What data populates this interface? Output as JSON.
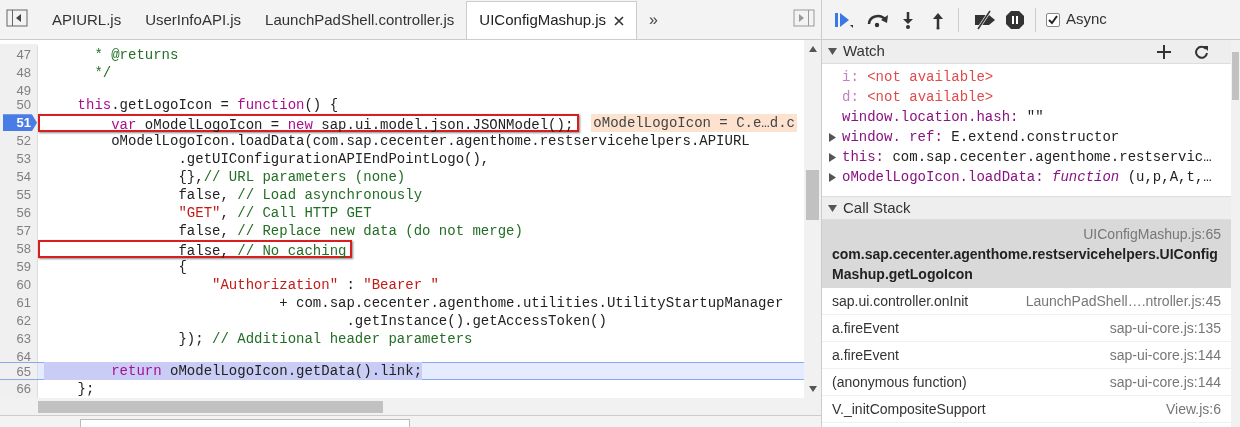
{
  "editor": {
    "tabs": [
      {
        "label": "APIURL.js",
        "selected": false,
        "closable": false
      },
      {
        "label": "UserInfoAPI.js",
        "selected": false,
        "closable": false
      },
      {
        "label": "LaunchPadShell.controller.js",
        "selected": false,
        "closable": false
      },
      {
        "label": "UIConfigMashup.js",
        "selected": true,
        "closable": true
      }
    ],
    "overflow": "»",
    "lines": [
      {
        "number": "47",
        "current": false,
        "selected": false,
        "boxed": false,
        "tokens": [
          {
            "t": "      * @returns",
            "kind": "comment"
          }
        ]
      },
      {
        "number": "48",
        "current": false,
        "selected": false,
        "boxed": false,
        "tokens": [
          {
            "t": "      */",
            "kind": "comment"
          }
        ]
      },
      {
        "number": "49",
        "current": false,
        "selected": false
      },
      {
        "number": "50",
        "current": false,
        "selected": false,
        "boxed": false,
        "tokens": [
          {
            "t": "    this",
            "kind": "keyword"
          },
          {
            "t": ".getLogoIcon = ",
            "kind": "plain"
          },
          {
            "t": "function",
            "kind": "keyword"
          },
          {
            "t": "() {",
            "kind": "plain"
          }
        ]
      },
      {
        "number": "51",
        "current": true,
        "selected": false,
        "boxed": true,
        "inline_value": "oModelLogoIcon = C.e…d.c",
        "tokens": [
          {
            "t": "        var",
            "kind": "keyword"
          },
          {
            "t": " oModelLogoIcon = ",
            "kind": "plain"
          },
          {
            "t": "new",
            "kind": "keyword"
          },
          {
            "t": " sap.ui.model.json.JSONModel();",
            "kind": "plain"
          }
        ]
      },
      {
        "number": "52",
        "current": false,
        "selected": false,
        "boxed": false,
        "tokens": [
          {
            "t": "        oModelLogoIcon.loadData(com.sap.cecenter.agenthome.restservicehelpers.APIURL",
            "kind": "plain"
          }
        ]
      },
      {
        "number": "53",
        "current": false,
        "selected": false,
        "boxed": false,
        "tokens": [
          {
            "t": "                .getUIConfigurationAPIEndPointLogo(),",
            "kind": "plain"
          }
        ]
      },
      {
        "number": "54",
        "current": false,
        "selected": false,
        "boxed": false,
        "tokens": [
          {
            "t": "                {},",
            "kind": "plain"
          },
          {
            "t": "// URL parameters (none)",
            "kind": "comment"
          }
        ]
      },
      {
        "number": "55",
        "current": false,
        "selected": false,
        "boxed": false,
        "tokens": [
          {
            "t": "                false, ",
            "kind": "plain"
          },
          {
            "t": "// Load asynchronously",
            "kind": "comment"
          }
        ]
      },
      {
        "number": "56",
        "current": false,
        "selected": false,
        "boxed": false,
        "tokens": [
          {
            "t": "                \"GET\"",
            "kind": "string"
          },
          {
            "t": ", ",
            "kind": "plain"
          },
          {
            "t": "// Call HTTP GET",
            "kind": "comment"
          }
        ]
      },
      {
        "number": "57",
        "current": false,
        "selected": false,
        "boxed": false,
        "tokens": [
          {
            "t": "                false, ",
            "kind": "plain"
          },
          {
            "t": "// Replace new data (do not merge)",
            "kind": "comment"
          }
        ]
      },
      {
        "number": "58",
        "current": false,
        "selected": false,
        "boxed": true,
        "tokens": [
          {
            "t": "                false, ",
            "kind": "plain"
          },
          {
            "t": "// No caching",
            "kind": "comment"
          }
        ]
      },
      {
        "number": "59",
        "current": false,
        "selected": false,
        "boxed": false,
        "tokens": [
          {
            "t": "                {",
            "kind": "plain"
          }
        ]
      },
      {
        "number": "60",
        "current": false,
        "selected": false,
        "boxed": false,
        "tokens": [
          {
            "t": "                    \"Authorization\"",
            "kind": "string"
          },
          {
            "t": " : ",
            "kind": "plain"
          },
          {
            "t": "\"Bearer \"",
            "kind": "string"
          }
        ]
      },
      {
        "number": "61",
        "current": false,
        "selected": false,
        "boxed": false,
        "tokens": [
          {
            "t": "                            + com.sap.cecenter.agenthome.utilities.UtilityStartupManager",
            "kind": "plain"
          }
        ]
      },
      {
        "number": "62",
        "current": false,
        "selected": false,
        "boxed": false,
        "tokens": [
          {
            "t": "                                    .getInstance().getAccessToken()",
            "kind": "plain"
          }
        ]
      },
      {
        "number": "63",
        "current": false,
        "selected": false,
        "boxed": false,
        "tokens": [
          {
            "t": "                }); ",
            "kind": "plain"
          },
          {
            "t": "// Additional header parameters",
            "kind": "comment"
          }
        ]
      },
      {
        "number": "64",
        "current": false,
        "selected": false
      },
      {
        "number": "65",
        "current": false,
        "selected": true,
        "boxed": false,
        "tokens": [
          {
            "t": "        return",
            "kind": "keyword"
          },
          {
            "t": " oModelLogoIcon.getData().link;",
            "kind": "plain"
          }
        ]
      },
      {
        "number": "66",
        "current": false,
        "selected": false,
        "boxed": false,
        "tokens": [
          {
            "t": "    };",
            "kind": "plain"
          }
        ]
      }
    ]
  },
  "debugger": {
    "async": {
      "label": "Async",
      "checked": true
    },
    "watch": {
      "title": "Watch",
      "expanded": true,
      "items": [
        {
          "name": "i:",
          "value": "<not available>",
          "error": true,
          "expandable": false
        },
        {
          "name": "d:",
          "value": "<not available>",
          "error": true,
          "expandable": false
        },
        {
          "name": "window.location.hash:",
          "value": "\"\"",
          "error": false,
          "expandable": false
        },
        {
          "name": "window. ref:",
          "value": "E.extend.constructor",
          "error": false,
          "expandable": true
        },
        {
          "name": "this:",
          "value": "com.sap.cecenter.agenthome.restservic…",
          "error": false,
          "expandable": true
        },
        {
          "name": "oModelLogoIcon.loadData:",
          "value_keyword": "function",
          "value": " (u,p,A,t,…",
          "error": false,
          "expandable": true
        }
      ]
    },
    "call_stack": {
      "title": "Call Stack",
      "expanded": true,
      "frames": [
        {
          "name": "com.sap.cecenter.agenthome.restservicehelpers.UIConfigMashup.getLogoIcon",
          "location": "UIConfigMashup.js:65",
          "selected": true
        },
        {
          "name": "sap.ui.controller.onInit",
          "location": "LaunchPadShell….ntroller.js:45",
          "selected": false
        },
        {
          "name": "a.fireEvent",
          "location": "sap-ui-core.js:135",
          "selected": false
        },
        {
          "name": "a.fireEvent",
          "location": "sap-ui-core.js:144",
          "selected": false
        },
        {
          "name": "(anonymous function)",
          "location": "sap-ui-core.js:144",
          "selected": false
        },
        {
          "name": "V._initCompositeSupport",
          "location": "View.js:6",
          "selected": false
        }
      ]
    }
  }
}
